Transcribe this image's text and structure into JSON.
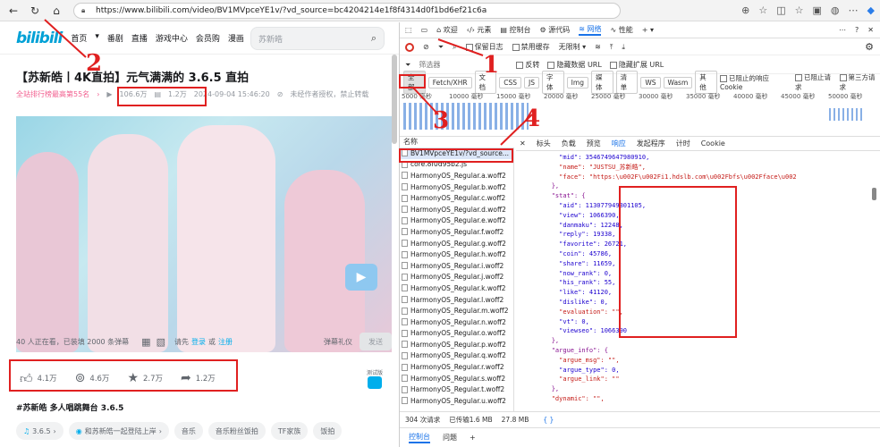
{
  "browser": {
    "url": "https://www.bilibili.com/video/BV1MVpceYE1v/?vd_source=bc4204214e1f8f4314d0f1bd6ef21c6a"
  },
  "annotations": [
    "1",
    "2",
    "3",
    "4"
  ],
  "bilibili": {
    "logo": "bilibili",
    "nav": [
      "首页",
      "番剧",
      "直播",
      "游戏中心",
      "会员购",
      "漫画",
      "赛事"
    ],
    "search_placeholder": "苏新皓",
    "video_title": "【苏新皓丨4K直拍】元气满满的 3.6.5 直拍",
    "rank": "全站排行榜最高第55名",
    "views": "106.6万",
    "danmaku": "1.2万",
    "date": "2024-09-04 15:46:20",
    "copyright": "未经作者授权，禁止转载",
    "watching": "40 人正在看，已装填 2000 条弹幕",
    "dm_prompt": "请先",
    "dm_login": "登录",
    "dm_or": "或",
    "dm_register": "注册",
    "dm_etiquette": "弹幕礼仪",
    "send": "发送",
    "actions": {
      "like": "4.1万",
      "coin": "4.6万",
      "favorite": "2.7万",
      "share": "1.2万"
    },
    "test_badge": "测试版",
    "tags_title": "#苏新皓 多人唱跳舞台 3.6.5",
    "tags": [
      "3.6.5",
      "和苏新皓一起登陆上岸",
      "音乐",
      "音乐粉丝饭拍",
      "TF家族",
      "饭拍"
    ]
  },
  "devtools": {
    "tabs": [
      "欢迎",
      "元素",
      "控制台",
      "源代码",
      "网络",
      "性能"
    ],
    "active_tab": "网络",
    "toolbar": {
      "preserve_log": "保留日志",
      "disable_cache": "禁用缓存",
      "throttle": "无限制"
    },
    "filter": {
      "placeholder": "筛选器",
      "invert": "反转",
      "hide_data": "隐藏数据 URL",
      "hide_ext": "隐藏扩展 URL"
    },
    "types": [
      "全部",
      "Fetch/XHR",
      "文档",
      "CSS",
      "JS",
      "字体",
      "Img",
      "媒体",
      "清单",
      "WS",
      "Wasm",
      "其他"
    ],
    "type_opts": [
      "已阻止的响应 Cookie",
      "已阻止请求",
      "第三方请求"
    ],
    "ticks": [
      "5000 毫秒",
      "10000 毫秒",
      "15000 毫秒",
      "20000 毫秒",
      "25000 毫秒",
      "30000 毫秒",
      "35000 毫秒",
      "40000 毫秒",
      "45000 毫秒",
      "50000 毫秒"
    ],
    "name_header": "名称",
    "requests": [
      "BV1MVpceYE1v/?vd_source...",
      "core.8f0d95b2.js",
      "HarmonyOS_Regular.a.woff2",
      "HarmonyOS_Regular.b.woff2",
      "HarmonyOS_Regular.c.woff2",
      "HarmonyOS_Regular.d.woff2",
      "HarmonyOS_Regular.e.woff2",
      "HarmonyOS_Regular.f.woff2",
      "HarmonyOS_Regular.g.woff2",
      "HarmonyOS_Regular.h.woff2",
      "HarmonyOS_Regular.i.woff2",
      "HarmonyOS_Regular.j.woff2",
      "HarmonyOS_Regular.k.woff2",
      "HarmonyOS_Regular.l.woff2",
      "HarmonyOS_Regular.m.woff2",
      "HarmonyOS_Regular.n.woff2",
      "HarmonyOS_Regular.o.woff2",
      "HarmonyOS_Regular.p.woff2",
      "HarmonyOS_Regular.q.woff2",
      "HarmonyOS_Regular.r.woff2",
      "HarmonyOS_Regular.s.woff2",
      "HarmonyOS_Regular.t.woff2",
      "HarmonyOS_Regular.u.woff2"
    ],
    "resp_tabs": [
      "标头",
      "负载",
      "预览",
      "响应",
      "发起程序",
      "计时",
      "Cookie"
    ],
    "active_resp_tab": "响应",
    "json_lines": [
      "          \"mid\": 3546749647980910,",
      "          \"name\": \"JUSTSU_苏新皓\",",
      "          \"face\": \"https:\\u002F\\u002Fi1.hdslb.com\\u002Fbfs\\u002Fface\\u002",
      "        },",
      "        \"stat\": {",
      "          \"aid\": 113077949301105,",
      "          \"view\": 1066390,",
      "          \"danmaku\": 12248,",
      "          \"reply\": 19338,",
      "          \"favorite\": 26721,",
      "          \"coin\": 45786,",
      "          \"share\": 11659,",
      "          \"now_rank\": 0,",
      "          \"his_rank\": 55,",
      "          \"like\": 41120,",
      "          \"dislike\": 0,",
      "          \"evaluation\": \"\",",
      "          \"vt\": 0,",
      "          \"viewseo\": 1066390",
      "        },",
      "        \"argue_info\": {",
      "          \"argue_msg\": \"\",",
      "          \"argue_type\": 0,",
      "          \"argue_link\": \"\"",
      "        },",
      "        \"dynamic\": \"\","
    ],
    "status": {
      "requests": "304 次请求",
      "transferred": "已传输1.6 MB",
      "resources": "27.8 MB",
      "braces": "{ }"
    },
    "bottom": {
      "console": "控制台",
      "issues": "问题",
      "add": "+"
    }
  }
}
